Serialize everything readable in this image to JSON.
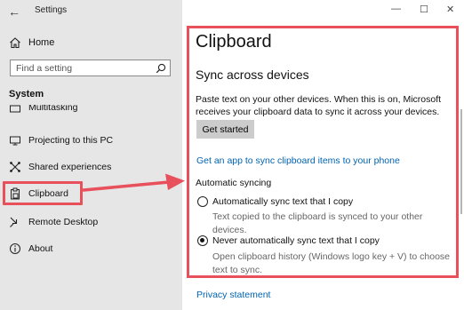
{
  "window": {
    "title": "Settings",
    "controls": [
      "—",
      "☐",
      "✕"
    ]
  },
  "sidebar": {
    "home_label": "Home",
    "search_placeholder": "Find a setting",
    "section_title": "System",
    "items": [
      {
        "label": "Multitasking",
        "icon": "multitasking-icon"
      },
      {
        "label": "Projecting to this PC",
        "icon": "projector-icon"
      },
      {
        "label": "Shared experiences",
        "icon": "shared-experiences-icon"
      },
      {
        "label": "Clipboard",
        "icon": "clipboard-icon"
      },
      {
        "label": "Remote Desktop",
        "icon": "remote-desktop-icon"
      },
      {
        "label": "About",
        "icon": "info-icon"
      }
    ]
  },
  "main": {
    "page_title": "Clipboard",
    "sync_title": "Sync across devices",
    "sync_description": "Paste text on your other devices. When this is on, Microsoft receives your clipboard data to sync it across your devices.",
    "get_started_label": "Get started",
    "app_link": "Get an app to sync clipboard items to your phone",
    "auto_sync_label": "Automatic syncing",
    "options": [
      {
        "label": "Automatically sync text that I copy",
        "description": "Text copied to the clipboard is synced to your other devices.",
        "checked": false
      },
      {
        "label": "Never automatically sync text that I copy",
        "description": "Open clipboard history (Windows logo key + V) to choose text to sync.",
        "checked": true
      }
    ],
    "privacy_link": "Privacy statement"
  },
  "colors": {
    "highlight": "#e8505b",
    "link": "#0063b1",
    "sidebar_bg": "#e6e6e6"
  }
}
